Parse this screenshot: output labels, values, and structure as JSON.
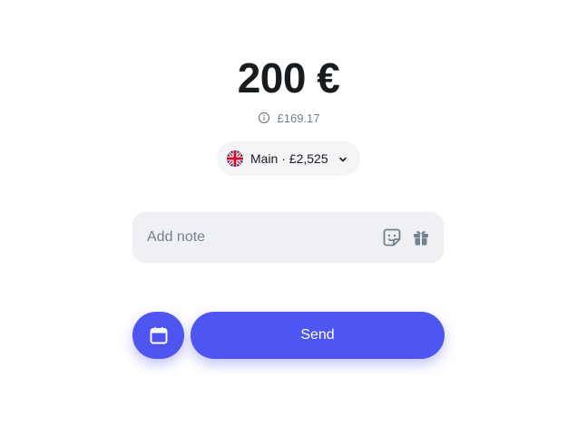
{
  "transfer": {
    "amount": "200 €",
    "converted_amount": "£169.17"
  },
  "account": {
    "label": "Main · £2,525",
    "flag": "uk-flag-icon"
  },
  "note": {
    "placeholder": "Add note",
    "value": "",
    "icons": [
      "sticker-icon",
      "gift-icon"
    ]
  },
  "actions": {
    "schedule_icon": "calendar-icon",
    "send_label": "Send"
  },
  "colors": {
    "accent": "#4f55f1",
    "text": "#191c1f",
    "muted": "#75808a",
    "field_bg": "#eff0f3"
  }
}
